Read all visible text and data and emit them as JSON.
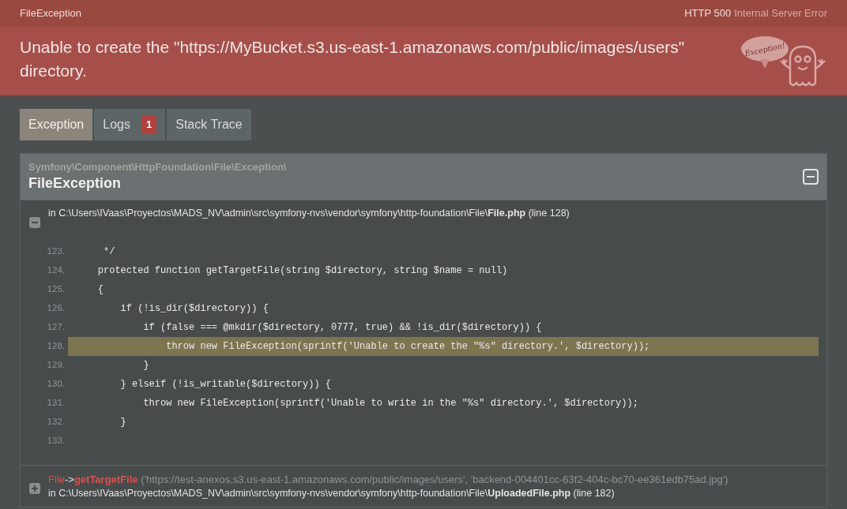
{
  "top_bar": {
    "exception_class": "FileException",
    "status_code": "HTTP 500",
    "status_text": "Internal Server Error"
  },
  "header": {
    "message": "Unable to create the \"https://MyBucket.s3.us-east-1.amazonaws.com/public/images/users\" directory.",
    "logo_text": "Exception!"
  },
  "tabs": [
    {
      "label": "Exception",
      "selected": true
    },
    {
      "label": "Logs",
      "badge": "1",
      "selected": false
    },
    {
      "label": "Stack Trace",
      "selected": false
    }
  ],
  "exception": {
    "namespace": "Symfony\\Component\\HttpFoundation\\File\\Exception\\",
    "name": "FileException",
    "expanded": true,
    "file_prefix": "in C:\\Users\\IVaas\\Proyectos\\MADS_NV\\admin\\src\\symfony-nvs\\vendor\\symfony\\http-foundation\\File\\",
    "file_name": "File.php",
    "line_label": "(line 128)",
    "code_lines": [
      {
        "number": "123.",
        "code": "     */",
        "highlighted": false
      },
      {
        "number": "124.",
        "code": "    protected function getTargetFile(string $directory, string $name = null)",
        "highlighted": false
      },
      {
        "number": "125.",
        "code": "    {",
        "highlighted": false
      },
      {
        "number": "126.",
        "code": "        if (!is_dir($directory)) {",
        "highlighted": false
      },
      {
        "number": "127.",
        "code": "            if (false === @mkdir($directory, 0777, true) && !is_dir($directory)) {",
        "highlighted": false
      },
      {
        "number": "128.",
        "code": "                throw new FileException(sprintf('Unable to create the \"%s\" directory.', $directory));",
        "highlighted": true
      },
      {
        "number": "129.",
        "code": "            }",
        "highlighted": false
      },
      {
        "number": "130.",
        "code": "        } elseif (!is_writable($directory)) {",
        "highlighted": false
      },
      {
        "number": "131.",
        "code": "            throw new FileException(sprintf('Unable to write in the \"%s\" directory.', $directory));",
        "highlighted": false
      },
      {
        "number": "132.",
        "code": "        }",
        "highlighted": false
      },
      {
        "number": "133.",
        "highlighted": false
      }
    ]
  },
  "trace": [
    {
      "expanded": false,
      "class": "File",
      "arrow": "->",
      "function": "getTargetFile",
      "args": "('https://test-anexos.s3.us-east-1.amazonaws.com/public/images/users', 'backend-004401cc-63f2-404c-bc70-ee361edb75ad.jpg')",
      "file_prefix": "in C:\\Users\\IVaas\\Proyectos\\MADS_NV\\admin\\src\\symfony-nvs\\vendor\\symfony\\http-foundation\\File\\",
      "file_name": "UploadedFile.php",
      "line_label": "(line 182)"
    }
  ]
}
